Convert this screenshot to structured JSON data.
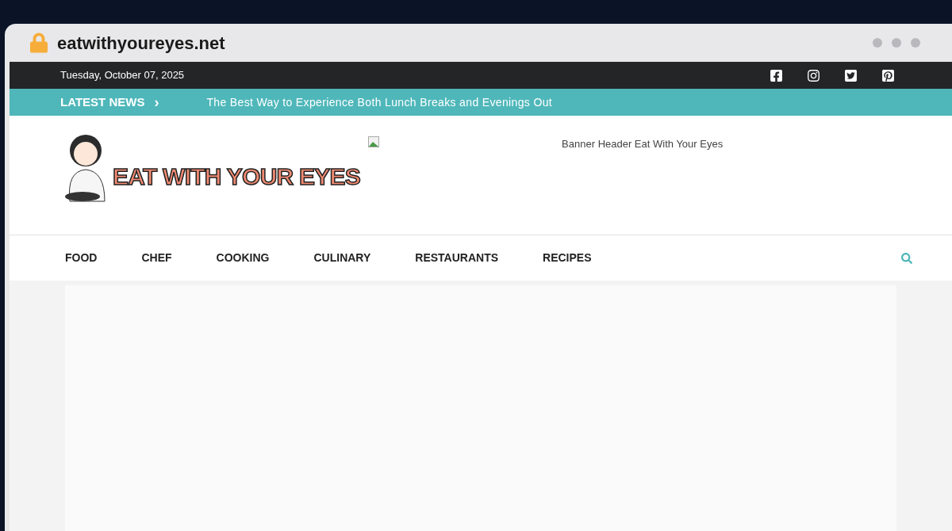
{
  "browser": {
    "url": "eatwithyoureyes.net"
  },
  "top_bar": {
    "date": "Tuesday, October 07, 2025"
  },
  "ticker": {
    "label": "LATEST NEWS",
    "arrow": "›",
    "headline": "The Best Way to Experience Both Lunch Breaks and Evenings Out"
  },
  "header": {
    "logo_text": "EAT WITH YOUR EYES",
    "banner_alt": "Banner Header Eat With Your Eyes"
  },
  "nav": {
    "items": [
      "FOOD",
      "CHEF",
      "COOKING",
      "CULINARY",
      "RESTAURANTS",
      "RECIPES"
    ]
  }
}
